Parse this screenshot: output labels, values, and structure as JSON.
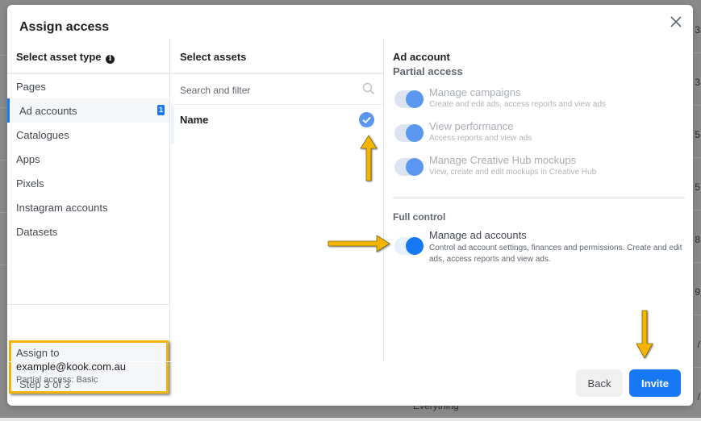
{
  "dialog": {
    "title": "Assign access",
    "close_icon": "close-icon"
  },
  "asset_types": {
    "heading": "Select asset type",
    "info_icon": "info-icon",
    "items": [
      {
        "label": "Pages",
        "active": false
      },
      {
        "label": "Ad accounts",
        "active": true,
        "badge": "1"
      },
      {
        "label": "Catalogues",
        "active": false
      },
      {
        "label": "Apps",
        "active": false
      },
      {
        "label": "Pixels",
        "active": false
      },
      {
        "label": "Instagram accounts",
        "active": false
      },
      {
        "label": "Datasets",
        "active": false
      }
    ]
  },
  "assign_to": {
    "label": "Assign to",
    "email": "example@kook.com.au",
    "level": "Partial access: Basic"
  },
  "assets": {
    "heading": "Select assets",
    "search_placeholder": "Search and filter",
    "search_value": "",
    "column_name": "Name",
    "select_all_checked": true
  },
  "permissions": {
    "title": "Ad account",
    "partial_heading": "Partial access",
    "partial": [
      {
        "label": "Manage campaigns",
        "desc": "Create and edit ads, access reports and view ads",
        "on": true,
        "disabled": true
      },
      {
        "label": "View performance",
        "desc": "Access reports and view ads",
        "on": true,
        "disabled": true
      },
      {
        "label": "Manage Creative Hub mockups",
        "desc": "View, create and edit mockups in Creative Hub",
        "on": true,
        "disabled": true
      }
    ],
    "full_heading": "Full control",
    "full": [
      {
        "label": "Manage ad accounts",
        "desc": "Control ad account settings, finances and permissions. Create and edit ads, access reports and view ads.",
        "on": true
      }
    ]
  },
  "footer": {
    "step": "Step 3 of 3",
    "back_label": "Back",
    "invite_label": "Invite"
  },
  "background": {
    "right_numbers": [
      "3",
      "3",
      "5",
      "5",
      "8",
      "9",
      "/",
      "/"
    ],
    "bottom_text": "Everything"
  },
  "colors": {
    "accent": "#1877f2",
    "highlight": "#f4b400"
  }
}
